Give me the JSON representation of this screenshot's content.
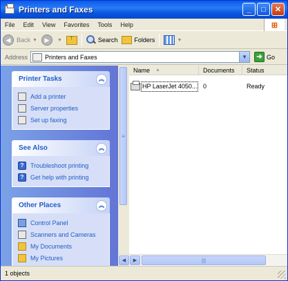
{
  "window": {
    "title": "Printers and Faxes",
    "controls": [
      "minimize",
      "maximize",
      "close"
    ]
  },
  "menu": {
    "items": [
      "File",
      "Edit",
      "View",
      "Favorites",
      "Tools",
      "Help"
    ]
  },
  "toolbar": {
    "back_label": "Back",
    "search_label": "Search",
    "folders_label": "Folders"
  },
  "address": {
    "label": "Address",
    "value": "Printers and Faxes",
    "go_label": "Go"
  },
  "panels": {
    "printer_tasks": {
      "title": "Printer Tasks",
      "items": [
        "Add a printer",
        "Server properties",
        "Set up faxing"
      ]
    },
    "see_also": {
      "title": "See Also",
      "items": [
        "Troubleshoot printing",
        "Get help with printing"
      ]
    },
    "other_places": {
      "title": "Other Places",
      "items": [
        "Control Panel",
        "Scanners and Cameras",
        "My Documents",
        "My Pictures"
      ]
    }
  },
  "list": {
    "columns": [
      "Name",
      "Documents",
      "Status"
    ],
    "rows": [
      {
        "name": "HP LaserJet 4050...",
        "documents": "0",
        "status": "Ready"
      }
    ]
  },
  "status_bar": {
    "text": "1 objects"
  }
}
